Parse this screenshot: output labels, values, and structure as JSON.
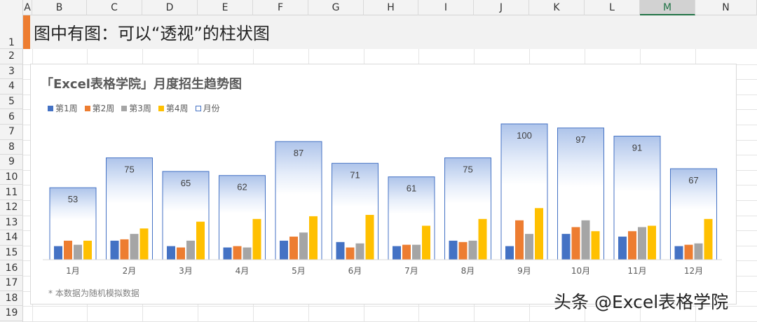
{
  "spreadsheet": {
    "columns": [
      "A",
      "B",
      "C",
      "D",
      "E",
      "F",
      "G",
      "H",
      "I",
      "J",
      "K",
      "L",
      "M",
      "N"
    ],
    "selected_column": "M",
    "rows": [
      "1",
      "2",
      "3",
      "4",
      "5",
      "6",
      "7",
      "8",
      "9",
      "10",
      "11",
      "12",
      "13",
      "14",
      "15",
      "16",
      "17",
      "18",
      "19"
    ],
    "sheet_title": "图中有图：可以“透视”的柱状图"
  },
  "chart_data": {
    "type": "bar",
    "title": "「Excel表格学院」月度招生趋势图",
    "categories": [
      "1月",
      "2月",
      "3月",
      "4月",
      "5月",
      "6月",
      "7月",
      "8月",
      "9月",
      "10月",
      "11月",
      "12月"
    ],
    "series": [
      {
        "name": "第1周",
        "color": "#4472c4",
        "values": [
          10,
          14,
          10,
          9,
          14,
          13,
          10,
          14,
          10,
          19,
          17,
          10
        ]
      },
      {
        "name": "第2周",
        "color": "#ed7d31",
        "values": [
          14,
          15,
          9,
          10,
          17,
          9,
          11,
          13,
          29,
          24,
          21,
          11
        ]
      },
      {
        "name": "第3周",
        "color": "#a5a5a5",
        "values": [
          11,
          19,
          14,
          9,
          20,
          12,
          11,
          14,
          19,
          29,
          24,
          12
        ]
      },
      {
        "name": "第4周",
        "color": "#ffc000",
        "values": [
          14,
          23,
          28,
          30,
          32,
          33,
          25,
          30,
          38,
          21,
          25,
          30
        ]
      },
      {
        "name": "月份",
        "color": "#4472c4",
        "values": [
          53,
          75,
          65,
          62,
          87,
          71,
          61,
          75,
          100,
          97,
          91,
          67
        ]
      }
    ],
    "ylim": [
      0,
      100
    ],
    "grid": false,
    "legend": "top-left"
  },
  "footnote": "* 本数据为随机模拟数据",
  "watermark": "头条 @Excel表格学院"
}
